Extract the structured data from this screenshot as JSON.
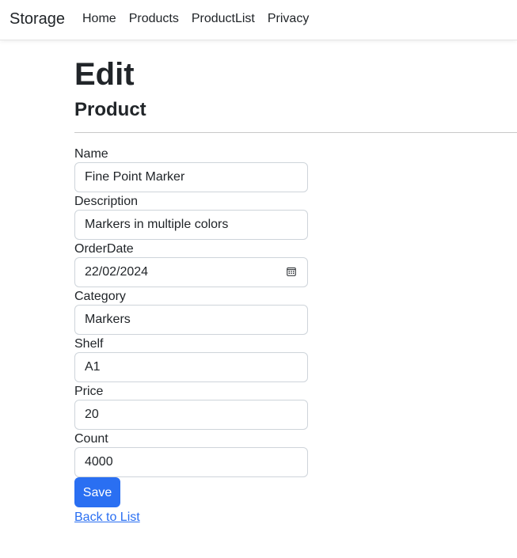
{
  "nav": {
    "brand": "Storage",
    "links": [
      "Home",
      "Products",
      "ProductList",
      "Privacy"
    ]
  },
  "page": {
    "title": "Edit",
    "subtitle": "Product"
  },
  "form": {
    "fields": [
      {
        "label": "Name",
        "value": "Fine Point Marker"
      },
      {
        "label": "Description",
        "value": "Markers in multiple colors"
      },
      {
        "label": "OrderDate",
        "value": "22/02/2024"
      },
      {
        "label": "Category",
        "value": "Markers"
      },
      {
        "label": "Shelf",
        "value": "A1"
      },
      {
        "label": "Price",
        "value": "20"
      },
      {
        "label": "Count",
        "value": "4000"
      }
    ],
    "save_label": "Save",
    "back_label": "Back to List"
  },
  "colors": {
    "primary": "#2a6ff2",
    "text": "#212529",
    "border": "#ced4da"
  },
  "icons": {
    "orderdate": "calendar-icon"
  }
}
